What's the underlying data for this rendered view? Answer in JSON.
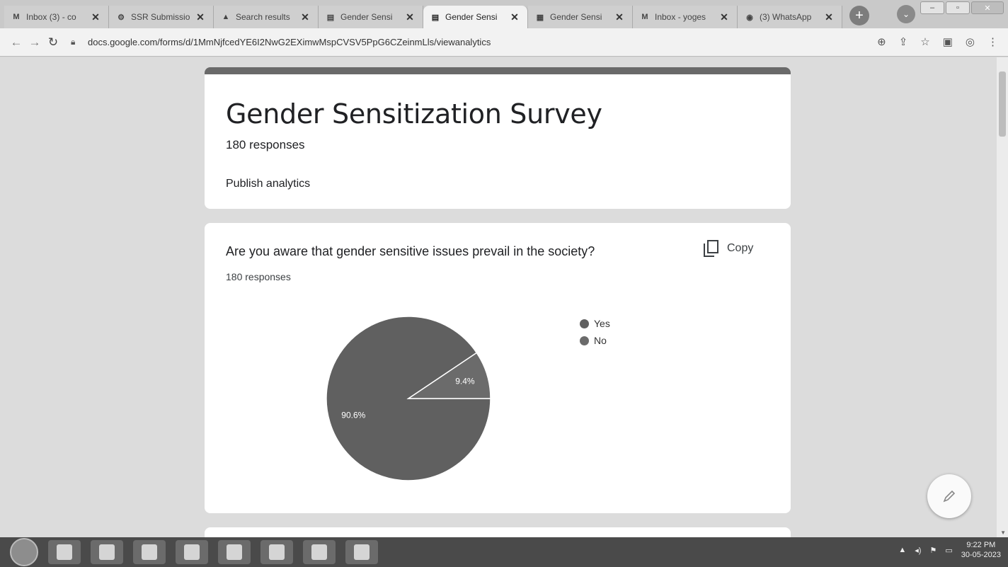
{
  "browser": {
    "tabs": [
      {
        "title": "Inbox (3) - co",
        "icon": "gmail-icon",
        "glyph": "M",
        "active": false
      },
      {
        "title": "SSR Submissio",
        "icon": "gear-icon",
        "glyph": "⚙",
        "active": false
      },
      {
        "title": "Search results",
        "icon": "drive-icon",
        "glyph": "▲",
        "active": false
      },
      {
        "title": "Gender Sensi",
        "icon": "forms-icon",
        "glyph": "▤",
        "active": false
      },
      {
        "title": "Gender Sensi",
        "icon": "forms-icon",
        "glyph": "▤",
        "active": true
      },
      {
        "title": "Gender Sensi",
        "icon": "sheets-icon",
        "glyph": "▦",
        "active": false
      },
      {
        "title": "Inbox - yoges",
        "icon": "gmail-icon",
        "glyph": "M",
        "active": false
      },
      {
        "title": "(3) WhatsApp",
        "icon": "whatsapp-icon",
        "glyph": "◉",
        "active": false
      }
    ],
    "close_glyph": "✕",
    "new_tab_glyph": "+",
    "url": "docs.google.com/forms/d/1MmNjfcedYE6I2NwG2EXimwMspCVSV5PpG6CZeinmLls/viewanalytics"
  },
  "form": {
    "title": "Gender Sensitization Survey",
    "responses": "180 responses",
    "publish_label": "Publish analytics"
  },
  "question": {
    "title": "Are you aware that gender sensitive issues prevail in the society?",
    "responses": "180 responses",
    "copy_label": "Copy"
  },
  "chart_data": {
    "type": "pie",
    "categories": [
      "Yes",
      "No"
    ],
    "values": [
      90.6,
      9.4
    ],
    "labels": [
      "90.6%",
      "9.4%"
    ],
    "colors": [
      "#606060",
      "#6b6b6b"
    ],
    "legend": "right"
  },
  "taskbar": {
    "time": "9:22 PM",
    "date": "30-05-2023"
  }
}
